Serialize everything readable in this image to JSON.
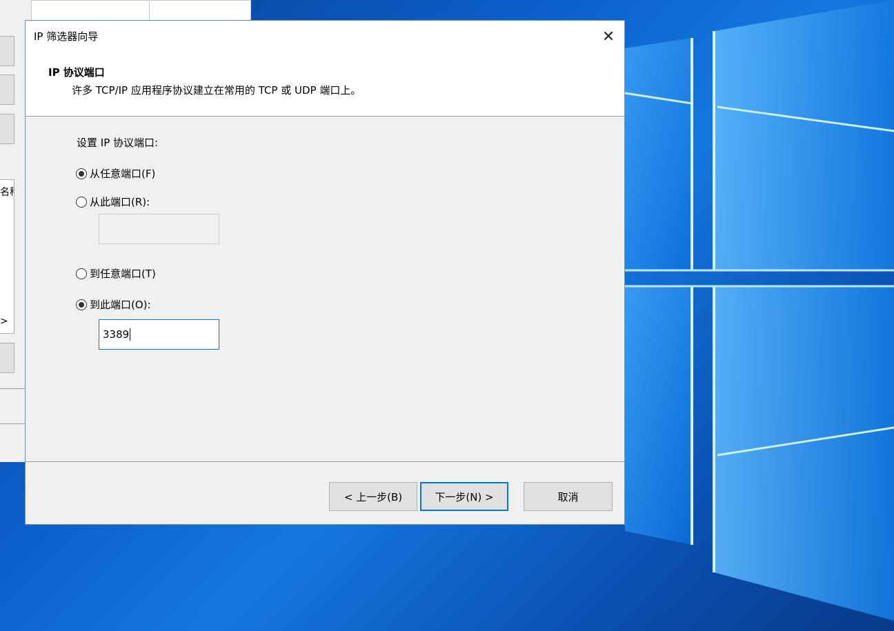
{
  "dialog": {
    "title": "IP 筛选器向导",
    "close_symbol": "✕",
    "header_title": "IP 协议端口",
    "header_subtitle": "许多 TCP/IP 应用程序协议建立在常用的 TCP 或 UDP 端口上。",
    "section_label": "设置 IP 协议端口:",
    "from_any_port": {
      "label": "从任意端口(F)",
      "checked": true
    },
    "from_this_port": {
      "label": "从此端口(R):",
      "checked": false,
      "value": ""
    },
    "to_any_port": {
      "label": "到任意端口(T)",
      "checked": false
    },
    "to_this_port": {
      "label": "到此端口(O):",
      "checked": true,
      "value": "3389"
    },
    "buttons": {
      "back": "< 上一步(B)",
      "next": "下一步(N) >",
      "cancel": "取消"
    }
  },
  "background_window": {
    "partial_column_text": "名称",
    "scroll_arrow": ">"
  }
}
